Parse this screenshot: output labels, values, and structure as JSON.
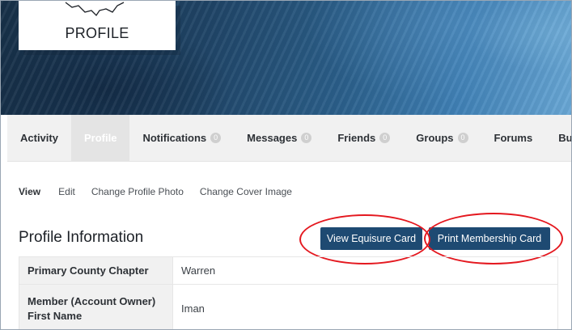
{
  "cover": {
    "logo_text": "PROFILE"
  },
  "nav": {
    "tabs": [
      {
        "label": "Activity",
        "badge": ""
      },
      {
        "label": "Profile",
        "badge": ""
      },
      {
        "label": "Notifications",
        "badge": "0"
      },
      {
        "label": "Messages",
        "badge": "0"
      },
      {
        "label": "Friends",
        "badge": "0"
      },
      {
        "label": "Groups",
        "badge": "0"
      },
      {
        "label": "Forums",
        "badge": ""
      },
      {
        "label": "Buddy",
        "badge": ""
      }
    ],
    "active_tab": "Profile"
  },
  "subnav": {
    "items": [
      "View",
      "Edit",
      "Change Profile Photo",
      "Change Cover Image"
    ]
  },
  "profile": {
    "title": "Profile Information",
    "view_equisure_label": "View Equisure Card",
    "print_card_label": "Print Membership Card",
    "rows": [
      {
        "label": "Primary County Chapter",
        "value": "Warren"
      },
      {
        "label": "Member (Account Owner) First Name",
        "value": "Iman"
      }
    ]
  },
  "colors": {
    "button_bg": "#1e4a72",
    "highlight_ring": "#e4181f",
    "nav_bg": "#f1f1f1"
  }
}
